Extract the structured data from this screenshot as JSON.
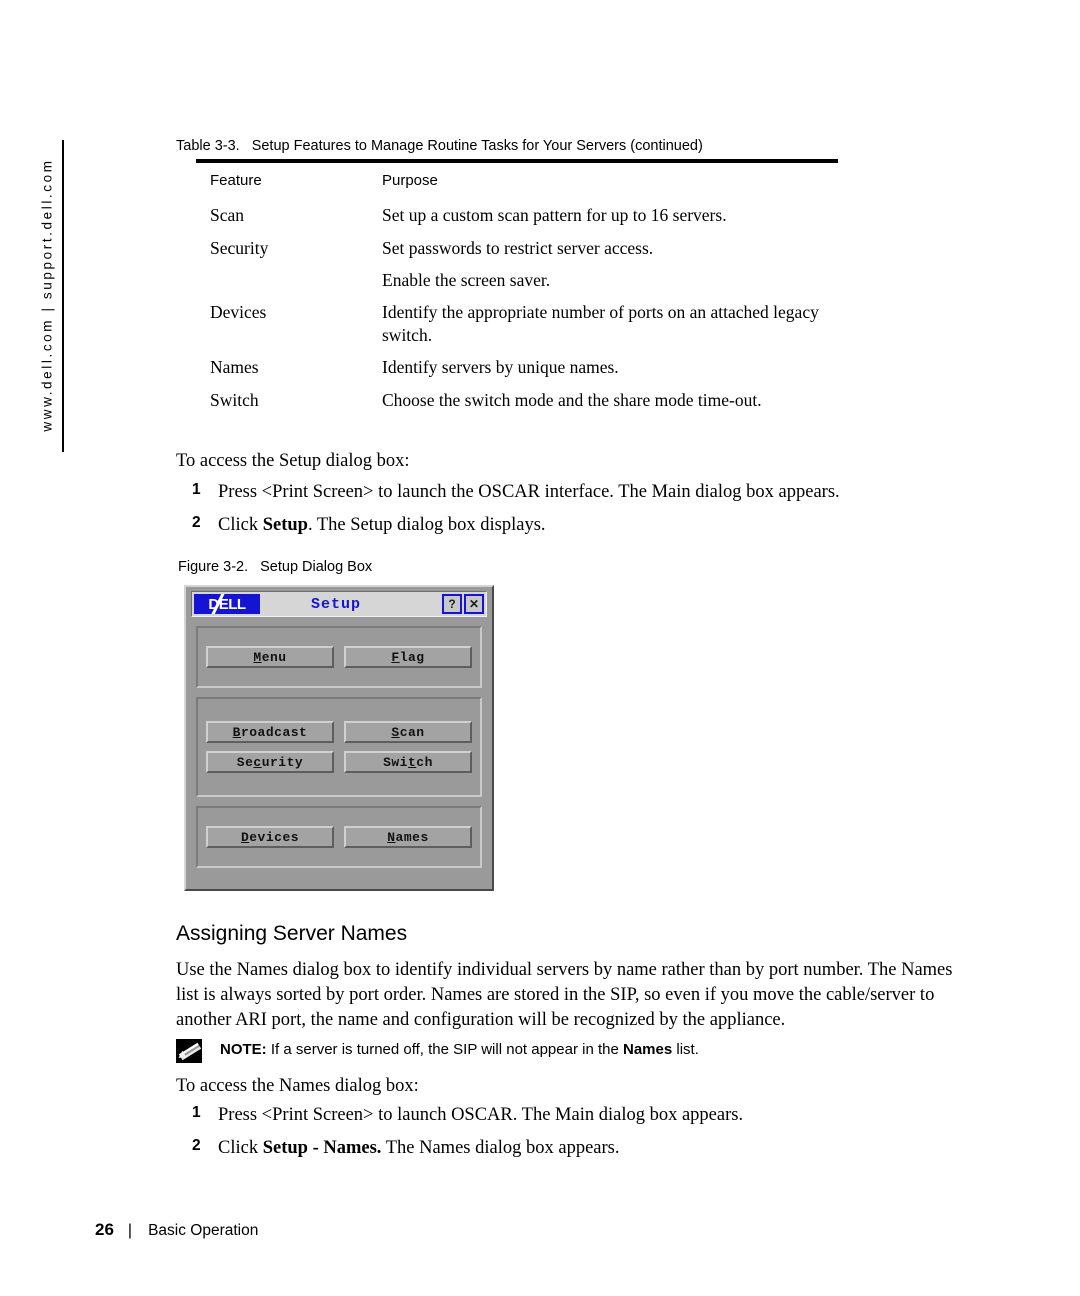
{
  "sidebar": {
    "url_text": "www.dell.com | support.dell.com"
  },
  "table": {
    "caption_number": "Table 3-3.",
    "caption_title": "Setup Features to Manage Routine Tasks for Your Servers (continued)",
    "columns": [
      "Feature",
      "Purpose"
    ],
    "rows": [
      {
        "feature": "Scan",
        "purpose": "Set up a custom scan pattern for up to 16 servers."
      },
      {
        "feature": "Security",
        "purpose": "Set passwords to restrict server access."
      },
      {
        "feature": "",
        "purpose": "Enable the screen saver."
      },
      {
        "feature": "Devices",
        "purpose": "Identify the appropriate number of ports on an attached legacy switch."
      },
      {
        "feature": "Names",
        "purpose": "Identify servers by unique names."
      },
      {
        "feature": "Switch",
        "purpose": "Choose the switch mode and the share mode time-out."
      }
    ]
  },
  "setup_access": {
    "lead": "To access the Setup dialog box:",
    "steps": [
      {
        "num": "1",
        "text_before": "Press <Print Screen> to launch the OSCAR interface. The Main dialog box appears.",
        "bold": "",
        "text_after": ""
      },
      {
        "num": "2",
        "text_before": "Click ",
        "bold": "Setup",
        "text_after": ". The Setup dialog box displays."
      }
    ]
  },
  "figure": {
    "caption_number": "Figure 3-2.",
    "caption_title": "Setup Dialog Box"
  },
  "dialog": {
    "logo_text": "DELL",
    "title": "Setup",
    "help_button": "?",
    "close_button": "✕",
    "groups": [
      {
        "buttons": [
          {
            "label": "Menu",
            "mnemonic_index": 0
          },
          {
            "label": "Flag",
            "mnemonic_index": 0
          }
        ]
      },
      {
        "buttons": [
          {
            "label": "Broadcast",
            "mnemonic_index": 0
          },
          {
            "label": "Scan",
            "mnemonic_index": 0
          },
          {
            "label": "Security",
            "mnemonic_index": 2
          },
          {
            "label": "Switch",
            "mnemonic_index": 3
          }
        ]
      },
      {
        "buttons": [
          {
            "label": "Devices",
            "mnemonic_index": 0
          },
          {
            "label": "Names",
            "mnemonic_index": 0
          }
        ]
      }
    ]
  },
  "section": {
    "heading": "Assigning Server Names",
    "paragraph": "Use the Names dialog box to identify individual servers by name rather than by port number. The Names list is always sorted by port order. Names are stored in the SIP, so even if you move the cable/server to another ARI port, the name and configuration will be recognized by the appliance."
  },
  "note": {
    "icon": "pencil-icon",
    "label": "NOTE:",
    "text_before": " If a server is turned off, the SIP will not appear in the ",
    "bold": "Names",
    "text_after": " list."
  },
  "names_access": {
    "lead": "To access the Names dialog box:",
    "steps": [
      {
        "num": "1",
        "text_before": "Press <Print Screen> to launch OSCAR. The Main dialog box appears.",
        "bold": "",
        "text_after": ""
      },
      {
        "num": "2",
        "text_before": "Click ",
        "bold": "Setup - Names.",
        "text_after": " The Names dialog box appears."
      }
    ]
  },
  "footer": {
    "page_number": "26",
    "separator": "|",
    "section_name": "Basic Operation"
  }
}
